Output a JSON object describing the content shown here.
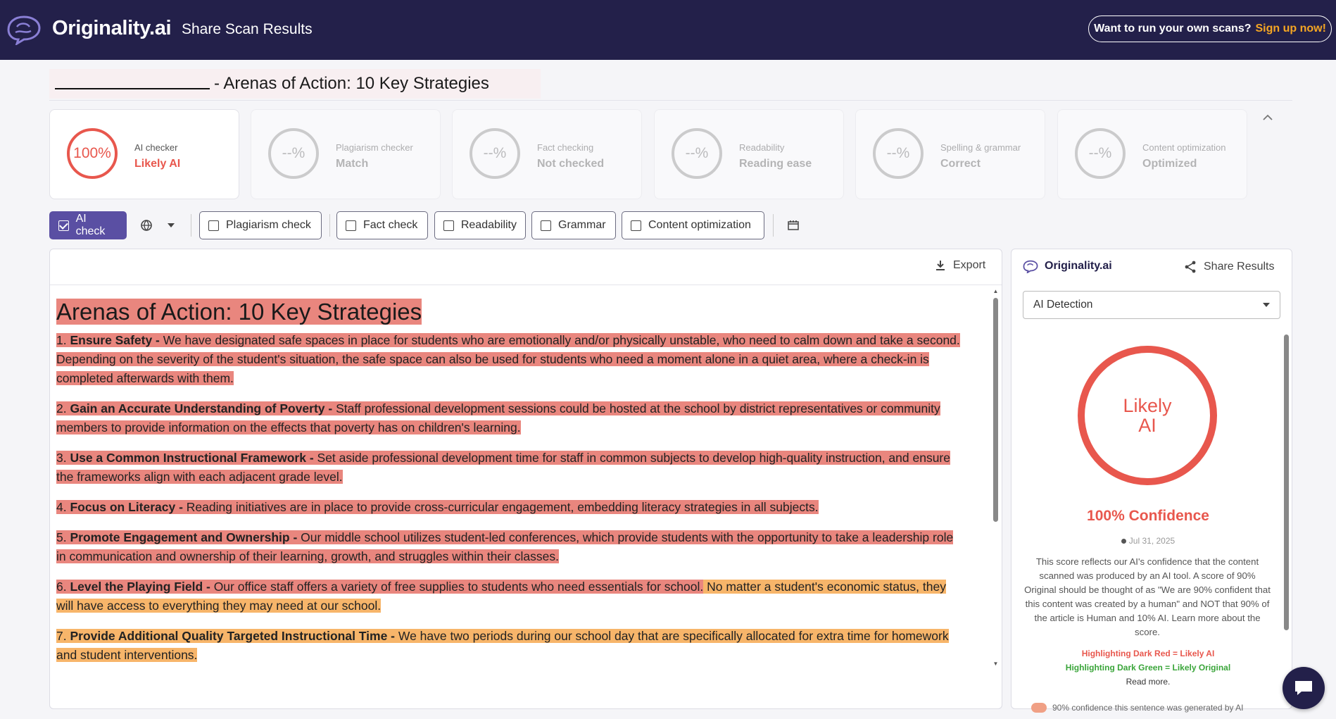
{
  "header": {
    "brand": "Originality.ai",
    "page_title": "Share Scan Results",
    "cta_question": "Want to run your own scans?",
    "cta_link": "Sign up now!"
  },
  "document": {
    "title": "- Arenas of Action: 10 Key Strategies"
  },
  "score_cards": [
    {
      "label": "AI checker",
      "score": "100%",
      "value": "Likely AI",
      "active": true
    },
    {
      "label": "Plagiarism checker",
      "score": "--%",
      "value": "Match",
      "active": false
    },
    {
      "label": "Fact checking",
      "score": "--%",
      "value": "Not checked",
      "active": false
    },
    {
      "label": "Readability",
      "score": "--%",
      "value": "Reading ease",
      "active": false
    },
    {
      "label": "Spelling & grammar",
      "score": "--%",
      "value": "Correct",
      "active": false
    },
    {
      "label": "Content optimization",
      "score": "--%",
      "value": "Optimized",
      "active": false
    }
  ],
  "toolbar": {
    "ai_check": "AI check",
    "plagiarism": "Plagiarism check",
    "fact": "Fact check",
    "readability": "Readability",
    "grammar": "Grammar",
    "content_opt": "Content optimization"
  },
  "doc_panel": {
    "export_label": "Export",
    "heading": "Arenas of Action: 10 Key Strategies",
    "paragraphs": [
      {
        "lead": "1. ",
        "bold": "Ensure Safety - ",
        "text": "We have designated safe spaces in place for students who are emotionally and/or physically unstable, who need to calm down and take a second.  Depending on the severity of the student's situation, the safe space can also be used for students who need a moment alone in a quiet area, where a check-in is completed afterwards with them."
      },
      {
        "lead": "2. ",
        "bold": "Gain an Accurate Understanding of Poverty - ",
        "text": "Staff professional development sessions could be hosted at the school by district representatives or community members to provide information on the effects that poverty has on children's learning."
      },
      {
        "lead": "3. ",
        "bold": "Use a Common Instructional Framework - ",
        "text": "Set aside professional development time for staff in common subjects to develop high-quality instruction, and ensure the frameworks align with each adjacent grade level."
      },
      {
        "lead": "4. ",
        "bold": "Focus on Literacy - ",
        "text": "Reading initiatives are in place to provide cross-curricular engagement, embedding literacy strategies in all subjects."
      },
      {
        "lead": "5. ",
        "bold": "Promote Engagement and Ownership - ",
        "text": "Our middle school utilizes student-led conferences, which provide students with the opportunity to take a leadership role in communication and ownership of their learning, growth, and struggles within their classes."
      },
      {
        "lead": "6. ",
        "bold": "Level the Playing Field - ",
        "text": "Our office staff offers a variety of free supplies to students who need essentials for school.",
        "text2": " No matter a student's economic status, they will have access to everything they may need at our school."
      },
      {
        "lead": "7. ",
        "bold": "Provide Additional Quality Targeted Instructional Time - ",
        "text": "We have two periods during our school day that are specifically allocated for extra time for homework and student interventions."
      }
    ]
  },
  "side_panel": {
    "brand": "Originality.ai",
    "share_label": "Share Results",
    "select_value": "AI Detection",
    "ring_line1": "Likely",
    "ring_line2": "AI",
    "confidence": "100% Confidence",
    "date": "Jul 31, 2025",
    "explanation": "This score reflects our AI's confidence that the content scanned was produced by an AI tool. A score of 90% Original should be thought of as \"We are 90% confident that this content was created by a human\" and NOT that 90% of the article is Human and 10% AI. Learn more about the score.",
    "legend_red": "Highlighting Dark Red = Likely AI",
    "legend_green": "Highlighting Dark Green = Likely Original",
    "read_more": "Read more.",
    "cutoff_text": "90% confidence this sentence was generated by AI"
  },
  "colors": {
    "header_bg": "#23204a",
    "accent_purple": "#5a4fa3",
    "ai_red": "#e8574d",
    "highlight_red": "#e9867e",
    "highlight_orange": "#f7b56a",
    "cta_orange": "#f5a623",
    "original_green": "#3aa53a"
  },
  "icons": [
    "brain-logo-icon",
    "export-download-icon",
    "share-icon",
    "chevron-down-icon",
    "chevron-up-icon",
    "language-globe-icon",
    "calendar-icon",
    "chat-icon",
    "scroll-up-icon",
    "scroll-down-icon"
  ]
}
